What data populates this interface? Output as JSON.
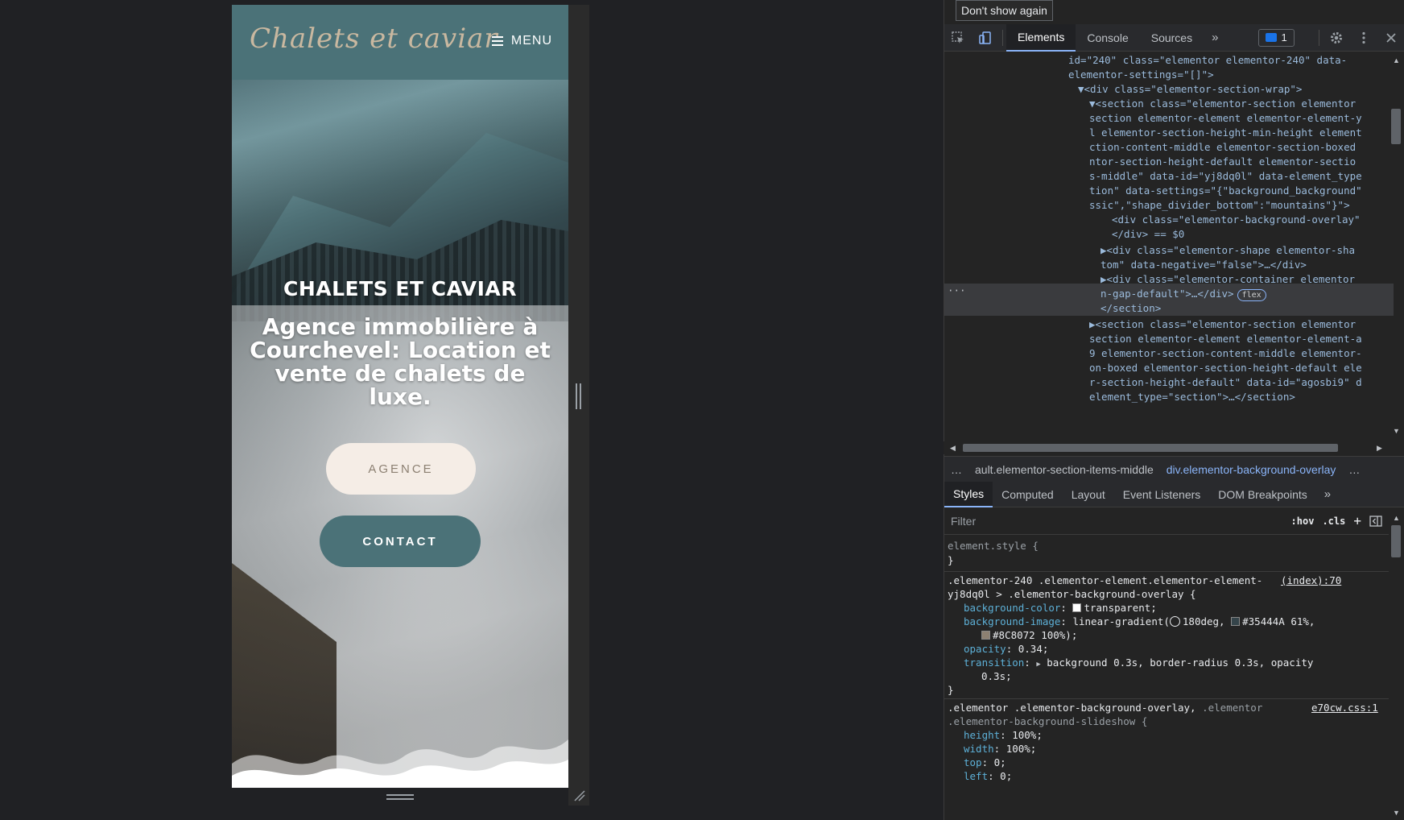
{
  "site": {
    "logo_text": "Chalets et caviar",
    "menu_label": "MENU",
    "hero_title": "CHALETS ET CAVIAR",
    "hero_subtitle": "Agence immobilière à Courchevel: Location et vente de chalets de luxe.",
    "btn_agence": "AGENCE",
    "btn_contact": "CONTACT",
    "colors": {
      "header": "#4b7278",
      "btn_light": "#f5ede6",
      "btn_light_text": "#8c8072"
    }
  },
  "devtools": {
    "dont_show": "Don't show again",
    "tabs": [
      "Elements",
      "Console",
      "Sources"
    ],
    "more_tabs": "»",
    "issues_count": "1",
    "icons": [
      "inspect-icon",
      "device-toggle-icon",
      "gear-icon",
      "kebab-icon",
      "close-icon"
    ],
    "dom": [
      "id=\"240\" class=\"elementor elementor-240\" data-",
      "elementor-settings=\"[]\">",
      "▼<div class=\"elementor-section-wrap\">",
      "▼<section class=\"elementor-section elementor",
      "section elementor-element elementor-element-y",
      "l elementor-section-height-min-height element",
      "ction-content-middle elementor-section-boxed",
      "ntor-section-height-default elementor-sectio",
      "s-middle\" data-id=\"yj8dq0l\" data-element_type",
      "tion\" data-settings=\"{\"background_background\"",
      "ssic\",\"shape_divider_bottom\":\"mountains\"}\">",
      "<div class=\"elementor-background-overlay\"",
      "</div> == $0",
      "▶<div class=\"elementor-shape elementor-sha",
      "tom\" data-negative=\"false\">…</div>",
      "▶<div class=\"elementor-container elementor",
      "n-gap-default\">…</div>",
      "</section>",
      "▶<section class=\"elementor-section elementor",
      "section elementor-element elementor-element-a",
      "9 elementor-section-content-middle elementor-",
      "on-boxed elementor-section-height-default ele",
      "r-section-height-default\" data-id=\"agosbi9\" d",
      "element_type=\"section\">…</section>"
    ],
    "flex_badge": "flex",
    "breadcrumbs": [
      "…",
      "ault.elementor-section-items-middle",
      "div.elementor-background-overlay",
      "…"
    ],
    "style_tabs": [
      "Styles",
      "Computed",
      "Layout",
      "Event Listeners",
      "DOM Breakpoints"
    ],
    "filter_placeholder": "Filter",
    "hov": ":hov",
    "cls": ".cls",
    "plus": "+",
    "styles": {
      "element_style": "element.style {",
      "close_brace": "}",
      "rule1_selector_a": ".elementor-240 .elementor-element.elementor-element-",
      "rule1_selector_b": "yj8dq0l > .elementor-background-overlay {",
      "rule1_source": "(index):70",
      "bg_color_prop": "background-color",
      "bg_color_val": "transparent;",
      "bg_image_prop": "background-image",
      "bg_image_val_a": "linear-gradient(",
      "bg_image_val_b": "180deg, ",
      "bg_image_val_c": "#35444A 61%,",
      "bg_image_val_d": "#8C8072 100%);",
      "opacity_prop": "opacity",
      "opacity_val": "0.34;",
      "transition_prop": "transition",
      "transition_val_a": "background 0.3s, border-radius 0.3s, opacity",
      "transition_val_b": "0.3s;",
      "rule2_selector_a": ".elementor .elementor-background-overlay,",
      "rule2_selector_a2": ".elementor",
      "rule2_selector_b": ".elementor-background-slideshow {",
      "rule2_source": "e70cw.css:1",
      "height_prop": "height",
      "height_val": "100%;",
      "width_prop": "width",
      "width_val": "100%;",
      "top_prop": "top",
      "top_val": "0;",
      "left_prop": "left",
      "left_val": "0;"
    }
  }
}
